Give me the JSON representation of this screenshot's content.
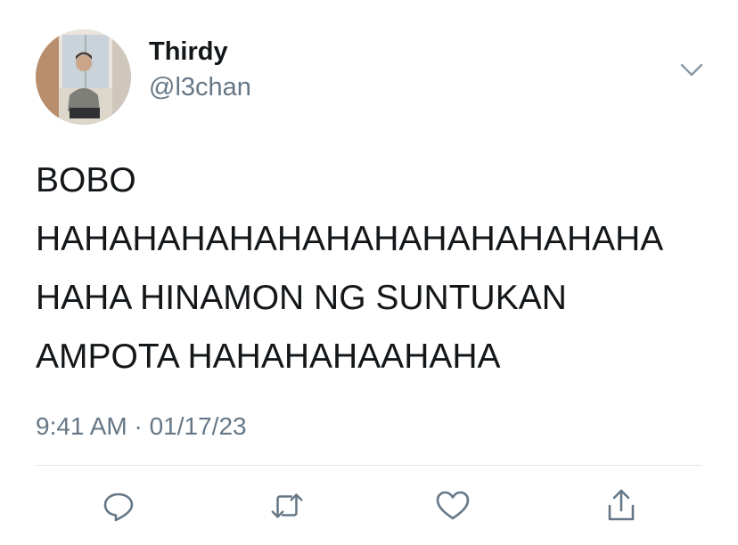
{
  "tweet": {
    "display_name": "Thirdy",
    "handle": "@l3chan",
    "text_lines": [
      "BOBO",
      "HAHAHAHAHAHAHAHAHAHAHAHAHA",
      "HAHA HINAMON NG SUNTUKAN",
      "AMPOTA HAHAHAHAAHAHA"
    ],
    "timestamp": "9:41 AM · 01/17/23"
  },
  "icons": {
    "menu": "chevron-down-icon",
    "actions": [
      "reply-icon",
      "retweet-icon",
      "like-icon",
      "share-icon"
    ]
  },
  "colors": {
    "text": "#14171a",
    "secondary": "#657786",
    "icon": "#657786",
    "divider": "#e1e8ed"
  }
}
